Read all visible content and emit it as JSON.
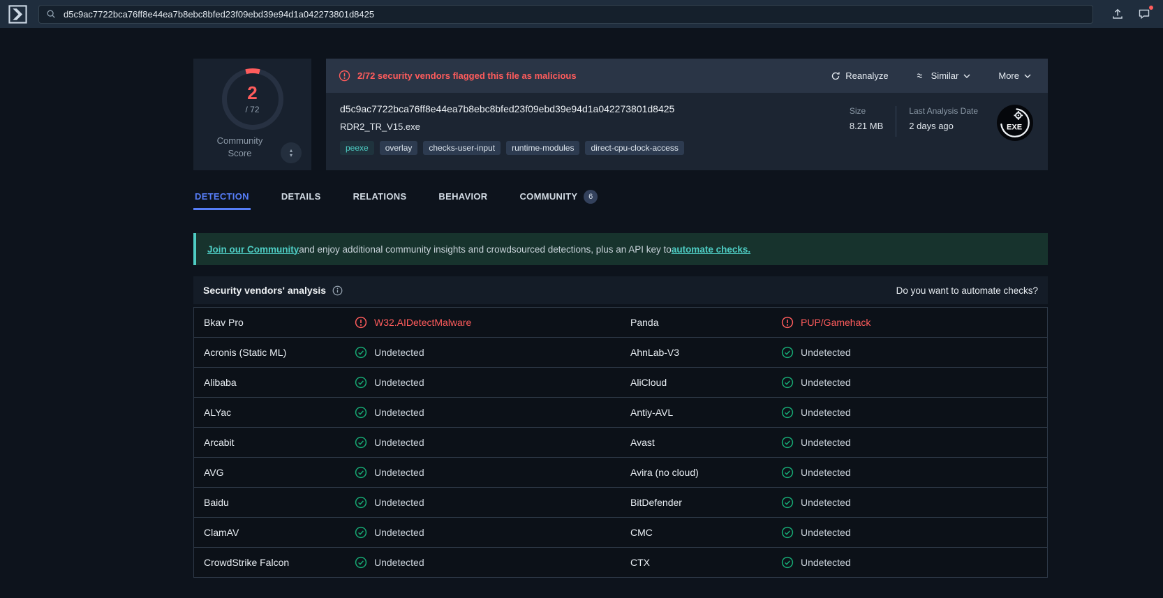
{
  "colors": {
    "malicious_red": "#ff5c5c",
    "check_green": "#17aa74",
    "accent_teal": "#4ecdc4",
    "tab_active_blue": "#567df6"
  },
  "topbar": {
    "search_value": "d5c9ac7722bca76ff8e44ea7b8ebc8bfed23f09ebd39e94d1a042273801d8425"
  },
  "score": {
    "value": "2",
    "total": "/ 72",
    "label": "Community Score"
  },
  "alert": {
    "message": "2/72 security vendors flagged this file as malicious",
    "reanalyze_label": "Reanalyze",
    "similar_label": "Similar",
    "more_label": "More"
  },
  "file": {
    "hash": "d5c9ac7722bca76ff8e44ea7b8ebc8bfed23f09ebd39e94d1a042273801d8425",
    "name": "RDR2_TR_V15.exe",
    "tags": [
      {
        "label": "peexe",
        "accent": true
      },
      {
        "label": "overlay"
      },
      {
        "label": "checks-user-input"
      },
      {
        "label": "runtime-modules"
      },
      {
        "label": "direct-cpu-clock-access"
      }
    ],
    "size_label": "Size",
    "size_value": "8.21 MB",
    "last_analysis_label": "Last Analysis Date",
    "last_analysis_value": "2 days ago",
    "type_badge": "EXE"
  },
  "tabs": [
    {
      "label": "DETECTION",
      "active": true
    },
    {
      "label": "DETAILS",
      "active": false
    },
    {
      "label": "RELATIONS",
      "active": false
    },
    {
      "label": "BEHAVIOR",
      "active": false
    },
    {
      "label": "COMMUNITY",
      "active": false,
      "badge": "6"
    }
  ],
  "banner": {
    "link1": "Join our Community",
    "middle": " and enjoy additional community insights and crowdsourced detections, plus an API key to ",
    "link2": "automate checks."
  },
  "analysis": {
    "title": "Security vendors' analysis",
    "automate_prompt": "Do you want to automate checks?",
    "rows": [
      [
        {
          "vendor": "Bkav Pro",
          "result": "W32.AIDetectMalware",
          "status": "malicious"
        },
        {
          "vendor": "Panda",
          "result": "PUP/Gamehack",
          "status": "malicious"
        }
      ],
      [
        {
          "vendor": "Acronis (Static ML)",
          "result": "Undetected",
          "status": "undetected"
        },
        {
          "vendor": "AhnLab-V3",
          "result": "Undetected",
          "status": "undetected"
        }
      ],
      [
        {
          "vendor": "Alibaba",
          "result": "Undetected",
          "status": "undetected"
        },
        {
          "vendor": "AliCloud",
          "result": "Undetected",
          "status": "undetected"
        }
      ],
      [
        {
          "vendor": "ALYac",
          "result": "Undetected",
          "status": "undetected"
        },
        {
          "vendor": "Antiy-AVL",
          "result": "Undetected",
          "status": "undetected"
        }
      ],
      [
        {
          "vendor": "Arcabit",
          "result": "Undetected",
          "status": "undetected"
        },
        {
          "vendor": "Avast",
          "result": "Undetected",
          "status": "undetected"
        }
      ],
      [
        {
          "vendor": "AVG",
          "result": "Undetected",
          "status": "undetected"
        },
        {
          "vendor": "Avira (no cloud)",
          "result": "Undetected",
          "status": "undetected"
        }
      ],
      [
        {
          "vendor": "Baidu",
          "result": "Undetected",
          "status": "undetected"
        },
        {
          "vendor": "BitDefender",
          "result": "Undetected",
          "status": "undetected"
        }
      ],
      [
        {
          "vendor": "ClamAV",
          "result": "Undetected",
          "status": "undetected"
        },
        {
          "vendor": "CMC",
          "result": "Undetected",
          "status": "undetected"
        }
      ],
      [
        {
          "vendor": "CrowdStrike Falcon",
          "result": "Undetected",
          "status": "undetected"
        },
        {
          "vendor": "CTX",
          "result": "Undetected",
          "status": "undetected"
        }
      ]
    ]
  }
}
